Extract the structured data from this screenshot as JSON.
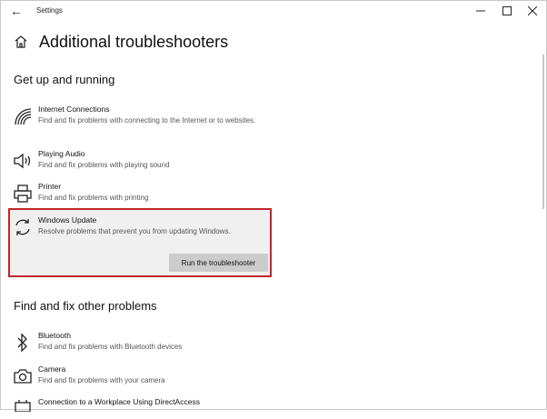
{
  "window": {
    "title": "Settings"
  },
  "page": {
    "title": "Additional troubleshooters"
  },
  "sections": [
    {
      "title": "Get up and running"
    },
    {
      "title": "Find and fix other problems"
    }
  ],
  "items": [
    {
      "name": "Internet Connections",
      "desc": "Find and fix problems with connecting to the Internet or to websites.",
      "icon": "wifi-icon"
    },
    {
      "name": "Playing Audio",
      "desc": "Find and fix problems with playing sound",
      "icon": "speaker-icon"
    },
    {
      "name": "Printer",
      "desc": "Find and fix problems with printing",
      "icon": "printer-icon"
    },
    {
      "name": "Windows Update",
      "desc": "Resolve problems that prevent you from updating Windows.",
      "icon": "refresh-icon"
    },
    {
      "name": "Bluetooth",
      "desc": "Find and fix problems with Bluetooth devices",
      "icon": "bluetooth-icon"
    },
    {
      "name": "Camera",
      "desc": "Find and fix problems with your camera",
      "icon": "camera-icon"
    },
    {
      "name": "Connection to a Workplace Using DirectAccess",
      "desc": "",
      "icon": "directaccess-icon"
    }
  ],
  "run_button_label": "Run the troubleshooter",
  "colors": {
    "highlight_border": "#c1272d",
    "selected_bg": "#f0f0f0",
    "button_bg": "#cccccc"
  }
}
